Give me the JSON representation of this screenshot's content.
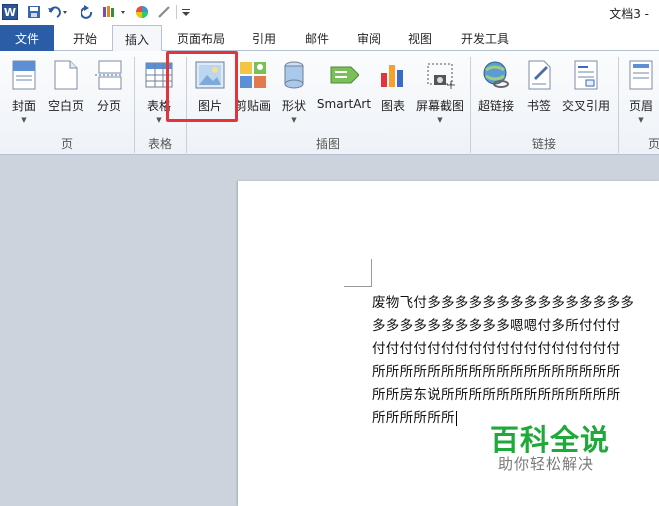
{
  "title_bar": {
    "doc_title": "文档3 -"
  },
  "tabs": [
    {
      "label": "文件"
    },
    {
      "label": "开始"
    },
    {
      "label": "插入"
    },
    {
      "label": "页面布局"
    },
    {
      "label": "引用"
    },
    {
      "label": "邮件"
    },
    {
      "label": "审阅"
    },
    {
      "label": "视图"
    },
    {
      "label": "开发工具"
    }
  ],
  "active_tab": "插入",
  "ribbon": {
    "buttons": {
      "cover": "封面",
      "blank_page": "空白页",
      "page_break": "分页",
      "table": "表格",
      "picture": "图片",
      "clip_art": "剪贴画",
      "shapes": "形状",
      "smartart": "SmartArt",
      "chart": "图表",
      "screenshot": "屏幕截图",
      "hyperlink": "超链接",
      "bookmark": "书签",
      "cross_ref": "交叉引用",
      "header": "页眉"
    },
    "groups": {
      "pages": "页",
      "tables": "表格",
      "illustrations": "插图",
      "links": "链接",
      "header_partial": "页"
    }
  },
  "document": {
    "lines": [
      "废物飞付多多多多多多多多多多多多多多多",
      "多多多多多多多多多多嗯嗯付多所付付付",
      "付付付付付付付付付付付付付付付付付付",
      "所所所所所所所所所所所所所所所所所所",
      "所所房东说所所所所所所所所所所所所所",
      "所所所所所所"
    ]
  },
  "watermark": {
    "main": "百科全说",
    "sub": "助你轻松解决"
  },
  "colors": {
    "file_tab": "#2a5da5",
    "highlight": "#e2353b",
    "watermark_green": "#1fa93a"
  }
}
